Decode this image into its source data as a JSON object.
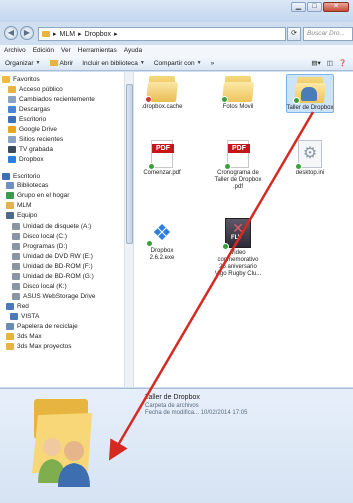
{
  "window": {
    "controls": {
      "minimize": "▁",
      "maximize": "□",
      "close": "✕"
    }
  },
  "address": {
    "crumbs": [
      "MLM",
      "Dropbox"
    ],
    "separator": "▸",
    "search_placeholder": "Buscar Dro..."
  },
  "menu": {
    "items": [
      "Archivo",
      "Edición",
      "Ver",
      "Herramientas",
      "Ayuda"
    ]
  },
  "toolbar": {
    "organize": "Organizar",
    "open": "Abrir",
    "include": "Incluir en biblioteca",
    "share": "Compartir con",
    "more": "»"
  },
  "nav": {
    "items": [
      "Favoritos",
      "Acceso público",
      "Cambiados recientemente",
      "Descargas",
      "Escritorio",
      "Google Drive",
      "Sitios recientes",
      "TV grabada",
      "Dropbox",
      "Escritorio",
      "Bibliotecas",
      "Grupo en el hogar",
      "MLM",
      "Equipo",
      "Unidad de disquete (A:)",
      "Disco local (C:)",
      "Programas (D:)",
      "Unidad de DVD RW (E:)",
      "Unidad de BD-ROM (F:)",
      "Unidad de BD-ROM (G:)",
      "Disco local (K:)",
      "ASUS WebStorage Drive",
      "Red",
      "VISTA",
      "Papelera de reciclaje",
      "3ds Max",
      "3ds Max proyectos"
    ]
  },
  "files": [
    {
      "name": ".dropbox.cache",
      "icon": "folder-icon",
      "status": "sync-error"
    },
    {
      "name": "Fotos Movil",
      "icon": "folder-icon",
      "status": "synced"
    },
    {
      "name": "Taller de Dropbox",
      "icon": "shared-folder-icon",
      "status": "synced",
      "selected": true
    },
    {
      "name": "Comenzar.pdf",
      "icon": "pdf-icon",
      "status": "synced"
    },
    {
      "name": "Cronograma de Taller de Dropbox .pdf",
      "icon": "pdf-icon",
      "status": "synced"
    },
    {
      "name": "desktop.ini",
      "icon": "settings-file-icon",
      "status": "synced"
    },
    {
      "name": "Dropbox 2.6.2.exe",
      "icon": "dropbox-icon",
      "status": "synced"
    },
    {
      "name": "Video conmemorativo 25 aniversario Vigo Rugby Clu...",
      "icon": "flv-icon",
      "status": "synced"
    }
  ],
  "pdf_badge": "PDF",
  "flv_badge": "FLV",
  "details": {
    "name": "Taller de Dropbox",
    "type": "Carpeta de archivos",
    "date_label": "Fecha de modifica...",
    "date_value": "10/02/2014 17:05"
  },
  "colors": {
    "accent_arrow": "#d42a22",
    "selection": "#cde3f8"
  }
}
